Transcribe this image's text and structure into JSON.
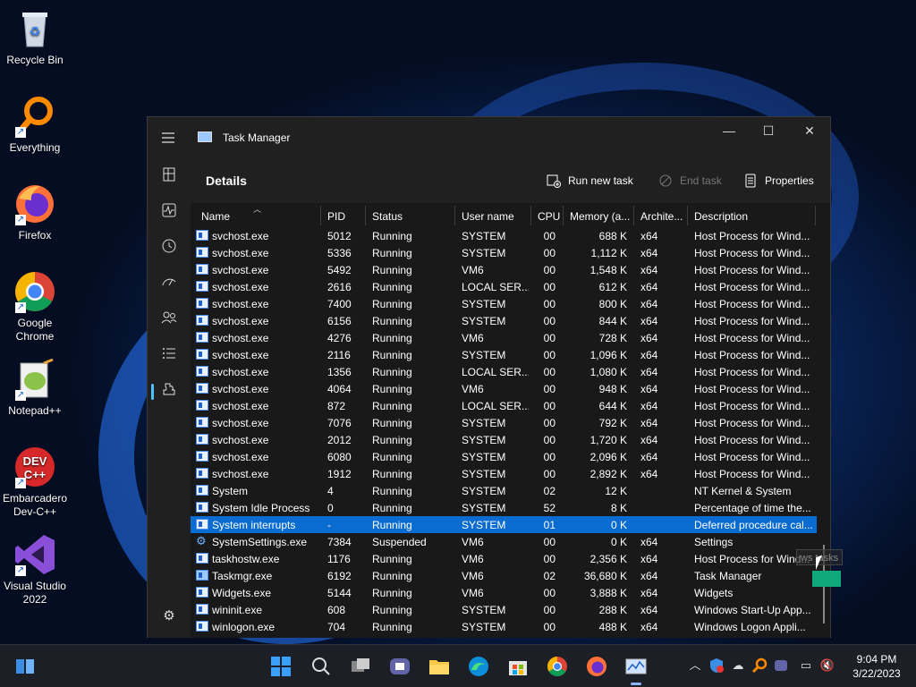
{
  "desktop": {
    "icons": [
      {
        "label": "Recycle Bin",
        "icon": "recycle-bin-icon"
      },
      {
        "label": "Everything",
        "icon": "search-magnifier-icon"
      },
      {
        "label": "Firefox",
        "icon": "firefox-icon"
      },
      {
        "label": "Google Chrome",
        "icon": "chrome-icon"
      },
      {
        "label": "Notepad++",
        "icon": "notepad-plus-plus-icon"
      },
      {
        "label": "Embarcadero Dev-C++",
        "icon": "devcpp-icon"
      },
      {
        "label": "Visual Studio 2022",
        "icon": "visual-studio-icon"
      }
    ]
  },
  "window": {
    "title": "Task Manager",
    "page_title": "Details",
    "actions": {
      "run_new_task": "Run new task",
      "end_task": "End task",
      "properties": "Properties"
    },
    "columns": {
      "name": "Name",
      "pid": "PID",
      "status": "Status",
      "user": "User name",
      "cpu": "CPU",
      "memory": "Memory (a...",
      "arch": "Archite...",
      "desc": "Description"
    },
    "rows": [
      {
        "name": "svchost.exe",
        "pid": "5012",
        "status": "Running",
        "user": "SYSTEM",
        "cpu": "00",
        "memory": "688 K",
        "arch": "x64",
        "desc": "Host Process for Wind...",
        "icon": "process-icon"
      },
      {
        "name": "svchost.exe",
        "pid": "5336",
        "status": "Running",
        "user": "SYSTEM",
        "cpu": "00",
        "memory": "1,112 K",
        "arch": "x64",
        "desc": "Host Process for Wind...",
        "icon": "process-icon"
      },
      {
        "name": "svchost.exe",
        "pid": "5492",
        "status": "Running",
        "user": "VM6",
        "cpu": "00",
        "memory": "1,548 K",
        "arch": "x64",
        "desc": "Host Process for Wind...",
        "icon": "process-icon"
      },
      {
        "name": "svchost.exe",
        "pid": "2616",
        "status": "Running",
        "user": "LOCAL SER...",
        "cpu": "00",
        "memory": "612 K",
        "arch": "x64",
        "desc": "Host Process for Wind...",
        "icon": "process-icon"
      },
      {
        "name": "svchost.exe",
        "pid": "7400",
        "status": "Running",
        "user": "SYSTEM",
        "cpu": "00",
        "memory": "800 K",
        "arch": "x64",
        "desc": "Host Process for Wind...",
        "icon": "process-icon"
      },
      {
        "name": "svchost.exe",
        "pid": "6156",
        "status": "Running",
        "user": "SYSTEM",
        "cpu": "00",
        "memory": "844 K",
        "arch": "x64",
        "desc": "Host Process for Wind...",
        "icon": "process-icon"
      },
      {
        "name": "svchost.exe",
        "pid": "4276",
        "status": "Running",
        "user": "VM6",
        "cpu": "00",
        "memory": "728 K",
        "arch": "x64",
        "desc": "Host Process for Wind...",
        "icon": "process-icon"
      },
      {
        "name": "svchost.exe",
        "pid": "2116",
        "status": "Running",
        "user": "SYSTEM",
        "cpu": "00",
        "memory": "1,096 K",
        "arch": "x64",
        "desc": "Host Process for Wind...",
        "icon": "process-icon"
      },
      {
        "name": "svchost.exe",
        "pid": "1356",
        "status": "Running",
        "user": "LOCAL SER...",
        "cpu": "00",
        "memory": "1,080 K",
        "arch": "x64",
        "desc": "Host Process for Wind...",
        "icon": "process-icon"
      },
      {
        "name": "svchost.exe",
        "pid": "4064",
        "status": "Running",
        "user": "VM6",
        "cpu": "00",
        "memory": "948 K",
        "arch": "x64",
        "desc": "Host Process for Wind...",
        "icon": "process-icon"
      },
      {
        "name": "svchost.exe",
        "pid": "872",
        "status": "Running",
        "user": "LOCAL SER...",
        "cpu": "00",
        "memory": "644 K",
        "arch": "x64",
        "desc": "Host Process for Wind...",
        "icon": "process-icon"
      },
      {
        "name": "svchost.exe",
        "pid": "7076",
        "status": "Running",
        "user": "SYSTEM",
        "cpu": "00",
        "memory": "792 K",
        "arch": "x64",
        "desc": "Host Process for Wind...",
        "icon": "process-icon"
      },
      {
        "name": "svchost.exe",
        "pid": "2012",
        "status": "Running",
        "user": "SYSTEM",
        "cpu": "00",
        "memory": "1,720 K",
        "arch": "x64",
        "desc": "Host Process for Wind...",
        "icon": "process-icon"
      },
      {
        "name": "svchost.exe",
        "pid": "6080",
        "status": "Running",
        "user": "SYSTEM",
        "cpu": "00",
        "memory": "2,096 K",
        "arch": "x64",
        "desc": "Host Process for Wind...",
        "icon": "process-icon"
      },
      {
        "name": "svchost.exe",
        "pid": "1912",
        "status": "Running",
        "user": "SYSTEM",
        "cpu": "00",
        "memory": "2,892 K",
        "arch": "x64",
        "desc": "Host Process for Wind...",
        "icon": "process-icon"
      },
      {
        "name": "System",
        "pid": "4",
        "status": "Running",
        "user": "SYSTEM",
        "cpu": "02",
        "memory": "12 K",
        "arch": "",
        "desc": "NT Kernel & System",
        "icon": "process-icon"
      },
      {
        "name": "System Idle Process",
        "pid": "0",
        "status": "Running",
        "user": "SYSTEM",
        "cpu": "52",
        "memory": "8 K",
        "arch": "",
        "desc": "Percentage of time the...",
        "icon": "process-icon"
      },
      {
        "name": "System interrupts",
        "pid": "-",
        "status": "Running",
        "user": "SYSTEM",
        "cpu": "01",
        "memory": "0 K",
        "arch": "",
        "desc": "Deferred procedure cal...",
        "icon": "process-icon",
        "selected": true
      },
      {
        "name": "SystemSettings.exe",
        "pid": "7384",
        "status": "Suspended",
        "user": "VM6",
        "cpu": "00",
        "memory": "0 K",
        "arch": "x64",
        "desc": "Settings",
        "icon": "settings-gear-icon"
      },
      {
        "name": "taskhostw.exe",
        "pid": "1176",
        "status": "Running",
        "user": "VM6",
        "cpu": "00",
        "memory": "2,356 K",
        "arch": "x64",
        "desc": "Host Process for Wind...",
        "icon": "process-icon"
      },
      {
        "name": "Taskmgr.exe",
        "pid": "6192",
        "status": "Running",
        "user": "VM6",
        "cpu": "02",
        "memory": "36,680 K",
        "arch": "x64",
        "desc": "Task Manager",
        "icon": "task-manager-icon"
      },
      {
        "name": "Widgets.exe",
        "pid": "5144",
        "status": "Running",
        "user": "VM6",
        "cpu": "00",
        "memory": "3,888 K",
        "arch": "x64",
        "desc": "Widgets",
        "icon": "process-icon"
      },
      {
        "name": "wininit.exe",
        "pid": "608",
        "status": "Running",
        "user": "SYSTEM",
        "cpu": "00",
        "memory": "288 K",
        "arch": "x64",
        "desc": "Windows Start-Up App...",
        "icon": "process-icon"
      },
      {
        "name": "winlogon.exe",
        "pid": "704",
        "status": "Running",
        "user": "SYSTEM",
        "cpu": "00",
        "memory": "488 K",
        "arch": "x64",
        "desc": "Windows Logon Appli...",
        "icon": "process-icon"
      }
    ],
    "tooltip": "ws tasks"
  },
  "taskbar": {
    "apps": [
      "windows-logo-icon",
      "search-icon",
      "task-view-icon",
      "teams-chat-icon",
      "file-explorer-icon",
      "edge-icon",
      "store-icon",
      "chrome-icon",
      "firefox-icon",
      "task-manager-icon"
    ],
    "clock_time": "9:04 PM",
    "clock_date": "3/22/2023"
  },
  "colors": {
    "selection": "#0a6cd0",
    "window_bg": "#1c1c1c",
    "accent": "#4cc2ff"
  }
}
